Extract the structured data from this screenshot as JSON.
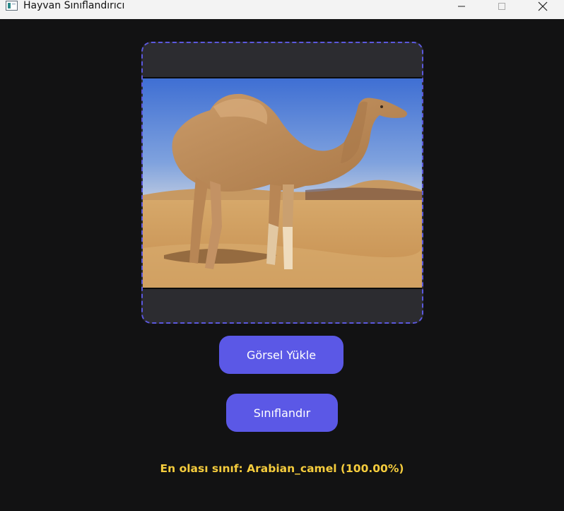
{
  "window": {
    "title": "Hayvan Sınıflandırıcı",
    "icon": "app-window-icon",
    "controls": {
      "minimize_icon": "minimize-icon",
      "maximize_icon": "maximize-icon",
      "close_icon": "close-icon"
    }
  },
  "upload_area": {
    "image_subject": "camel-photo",
    "border_color": "#5b58dd"
  },
  "buttons": {
    "upload_label": "Görsel Yükle",
    "classify_label": "Sınıflandır",
    "color": "#5b58e6"
  },
  "result": {
    "text": "En olası sınıf: Arabian_camel (100.00%)",
    "color": "#f5cc3d"
  }
}
